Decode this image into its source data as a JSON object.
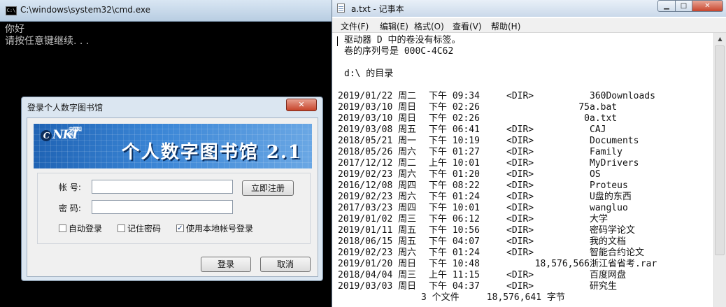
{
  "cmd": {
    "title": "C:\\windows\\system32\\cmd.exe",
    "output": [
      "你好",
      "请按任意键继续. . ."
    ]
  },
  "login": {
    "title": "登录个人数字图书馆",
    "close": "✕",
    "logo_text": "NKI",
    "logo_sub": "中国知网",
    "banner_title": "个人数字图书馆 2.1",
    "account_label": "帐 号:",
    "account_value": "",
    "password_label": "密 码:",
    "password_value": "",
    "register_button": "立即注册",
    "auto_login": {
      "label": "自动登录",
      "checked": false
    },
    "remember_password": {
      "label": "记住密码",
      "checked": false
    },
    "use_local_account": {
      "label": "使用本地帐号登录",
      "checked": true
    },
    "login_button": "登录",
    "cancel_button": "取消"
  },
  "notepad": {
    "title": "a.txt - 记事本",
    "menu": [
      "文件(F)",
      "编辑(E)",
      "格式(O)",
      "查看(V)",
      "帮助(H)"
    ],
    "header_lines": [
      "驱动器 D 中的卷没有标签。",
      "卷的序列号是 000C-4C62",
      "",
      "d:\\ 的目录"
    ],
    "rows": [
      {
        "date": "2019/01/22 周二",
        "time": "下午 09:34",
        "dir": "<DIR>",
        "size": "",
        "name": "360Downloads"
      },
      {
        "date": "2019/03/10 周日",
        "time": "下午 02:26",
        "dir": "",
        "size": "75",
        "name": "a.bat"
      },
      {
        "date": "2019/03/10 周日",
        "time": "下午 02:26",
        "dir": "",
        "size": "0",
        "name": "a.txt"
      },
      {
        "date": "2019/03/08 周五",
        "time": "下午 06:41",
        "dir": "<DIR>",
        "size": "",
        "name": "CAJ"
      },
      {
        "date": "2018/05/21 周一",
        "time": "下午 10:19",
        "dir": "<DIR>",
        "size": "",
        "name": "Documents"
      },
      {
        "date": "2018/05/26 周六",
        "time": "下午 01:27",
        "dir": "<DIR>",
        "size": "",
        "name": "Family"
      },
      {
        "date": "2017/12/12 周二",
        "time": "上午 10:01",
        "dir": "<DIR>",
        "size": "",
        "name": "MyDrivers"
      },
      {
        "date": "2019/02/23 周六",
        "time": "下午 01:20",
        "dir": "<DIR>",
        "size": "",
        "name": "OS"
      },
      {
        "date": "2016/12/08 周四",
        "time": "下午 08:22",
        "dir": "<DIR>",
        "size": "",
        "name": "Proteus"
      },
      {
        "date": "2019/02/23 周六",
        "time": "下午 01:24",
        "dir": "<DIR>",
        "size": "",
        "name": "U盘的东西"
      },
      {
        "date": "2017/03/23 周四",
        "time": "下午 10:01",
        "dir": "<DIR>",
        "size": "",
        "name": "wangluo"
      },
      {
        "date": "2019/01/02 周三",
        "time": "下午 06:12",
        "dir": "<DIR>",
        "size": "",
        "name": "大学"
      },
      {
        "date": "2019/01/11 周五",
        "time": "下午 10:56",
        "dir": "<DIR>",
        "size": "",
        "name": "密码学论文"
      },
      {
        "date": "2018/06/15 周五",
        "time": "下午 04:07",
        "dir": "<DIR>",
        "size": "",
        "name": "我的文档"
      },
      {
        "date": "2019/02/23 周六",
        "time": "下午 01:24",
        "dir": "<DIR>",
        "size": "",
        "name": "智能合约论文"
      },
      {
        "date": "2019/01/20 周日",
        "time": "下午 10:48",
        "dir": "",
        "size": "18,576,566",
        "name": "浙江省省考.rar"
      },
      {
        "date": "2018/04/04 周三",
        "time": "上午 11:15",
        "dir": "<DIR>",
        "size": "",
        "name": "百度网盘"
      },
      {
        "date": "2019/03/03 周日",
        "time": "下午 04:37",
        "dir": "<DIR>",
        "size": "",
        "name": "研究生"
      }
    ],
    "summary": "3 个文件     18,576,641 字节"
  }
}
